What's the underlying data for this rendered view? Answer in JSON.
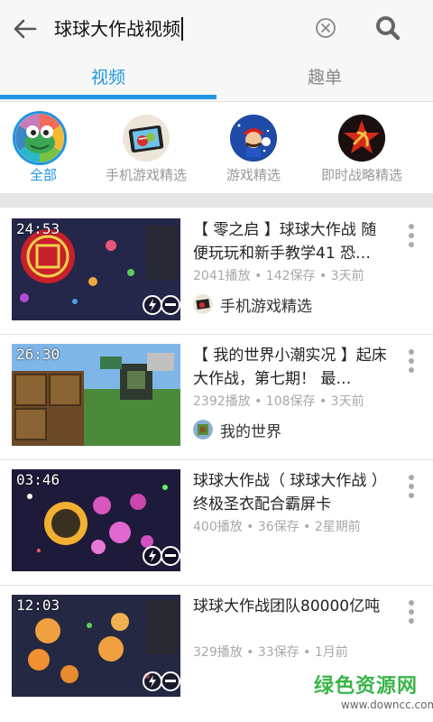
{
  "search": {
    "query": "球球大作战视频"
  },
  "tabs": [
    {
      "label": "视频",
      "active": true
    },
    {
      "label": "趣单",
      "active": false
    }
  ],
  "categories": [
    {
      "label": "全部",
      "icon": "rainbow-frog-icon",
      "active": true
    },
    {
      "label": "手机游戏精选",
      "icon": "angry-birds-tablet-icon",
      "active": false
    },
    {
      "label": "游戏精选",
      "icon": "mario-icon",
      "active": false
    },
    {
      "label": "即时战略精选",
      "icon": "red-star-emblem-icon",
      "active": false
    }
  ],
  "videos": [
    {
      "duration": "24:53",
      "title": "【 零之启 】球球大作战 随便玩玩和新手教学41 恐…",
      "stats": "2041播放 • 142保存 • 3天前",
      "channel": "手机游戏精选"
    },
    {
      "duration": "26:30",
      "title": "【 我的世界小潮实况 】起床大作战，第七期！ 最…",
      "stats": "2392播放 • 108保存 • 3天前",
      "channel": "我的世界"
    },
    {
      "duration": "03:46",
      "title": "球球大作战（ 球球大作战 ）终极圣衣配合霸屏卡",
      "stats": "400播放 • 36保存 • 2星期前",
      "channel": ""
    },
    {
      "duration": "12:03",
      "title": "球球大作战团队80000亿吨",
      "stats": "329播放 • 33保存 • 1月前",
      "channel": ""
    }
  ],
  "watermark": {
    "main": "绿色资源网",
    "sub": "www.downcc.com"
  },
  "colors": {
    "accent": "#2196e0",
    "watermark_green": "#3bb54a"
  }
}
